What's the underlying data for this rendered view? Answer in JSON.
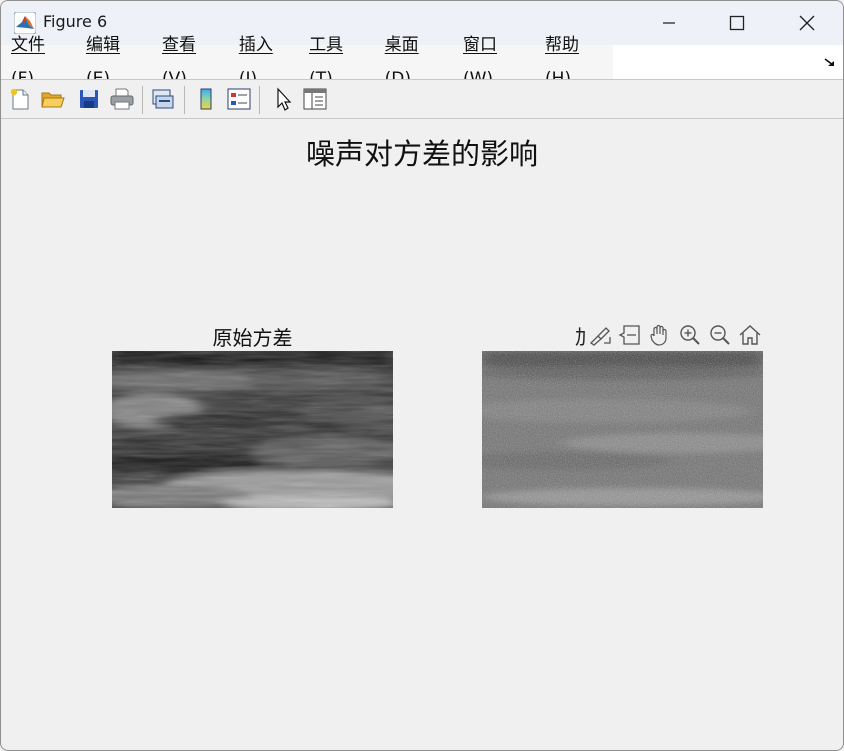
{
  "window": {
    "title": "Figure 6"
  },
  "menu": [
    "文件(F)",
    "编辑(E)",
    "查看(V)",
    "插入(I)",
    "工具(T)",
    "桌面(D)",
    "窗口(W)",
    "帮助(H)"
  ],
  "toolbar": {
    "icons": [
      "new-figure-icon",
      "open-file-icon",
      "save-icon",
      "print-icon",
      "link-plot-icon",
      "colorbar-icon",
      "legend-icon",
      "edit-plot-icon",
      "property-inspector-icon"
    ]
  },
  "figure": {
    "suptitle": "噪声对方差的影响",
    "left_axes_title": "原始方差",
    "right_axes_title_visible": "加"
  },
  "axes_toolbar": {
    "icons": [
      "brush-icon",
      "data-tips-icon",
      "pan-icon",
      "zoom-in-icon",
      "zoom-out-icon",
      "home-icon"
    ]
  }
}
